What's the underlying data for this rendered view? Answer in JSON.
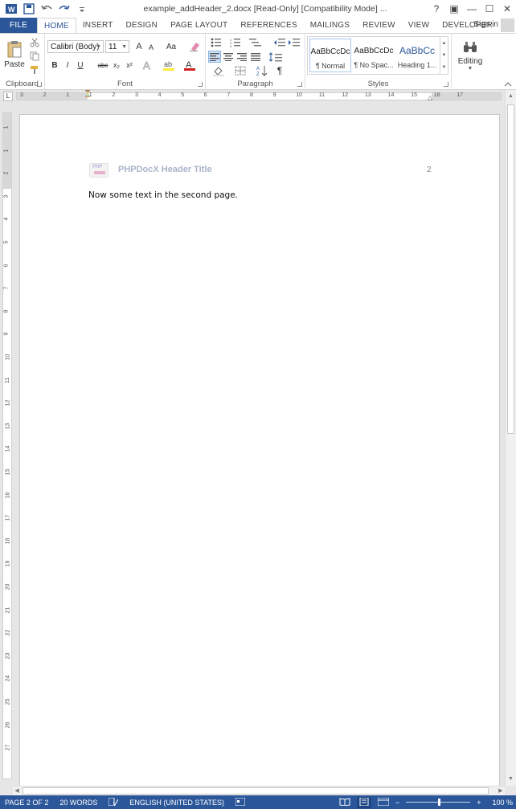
{
  "window": {
    "title": "example_addHeader_2.docx [Read-Only] [Compatibility Mode] ...",
    "help": "?",
    "restore": "▣",
    "minimize": "—",
    "maximize": "☐",
    "close": "✕"
  },
  "tabs": [
    "FILE",
    "HOME",
    "INSERT",
    "DESIGN",
    "PAGE LAYOUT",
    "REFERENCES",
    "MAILINGS",
    "REVIEW",
    "VIEW",
    "DEVELOPER"
  ],
  "active_tab": "HOME",
  "sign_in": "Sign in",
  "ribbon": {
    "clipboard": {
      "paste": "Paste",
      "label": "Clipboard"
    },
    "font": {
      "family": "Calibri (Body)",
      "size": "11",
      "grow": "A",
      "shrink": "A",
      "case": "Aa",
      "bold": "B",
      "italic": "I",
      "underline": "U",
      "strike": "abc",
      "subscript": "x₂",
      "superscript": "x²",
      "label": "Font"
    },
    "paragraph": {
      "label": "Paragraph",
      "pilcrow": "¶"
    },
    "styles": {
      "items": [
        {
          "preview": "AaBbCcDc",
          "name": "¶ Normal"
        },
        {
          "preview": "AaBbCcDc",
          "name": "¶ No Spac..."
        },
        {
          "preview": "AaBbCc",
          "name": "Heading 1..."
        }
      ],
      "label": "Styles"
    },
    "editing": {
      "label": "Editing"
    }
  },
  "ruler": {
    "h_numbers": [
      "3",
      "2",
      "1",
      "1",
      "2",
      "3",
      "4",
      "5",
      "6",
      "7",
      "8",
      "9",
      "10",
      "11",
      "12",
      "13",
      "14",
      "15",
      "16",
      "17"
    ],
    "v_numbers": [
      "1",
      "1",
      "2",
      "3",
      "4",
      "5",
      "6",
      "7",
      "8",
      "9",
      "10",
      "11",
      "12",
      "13",
      "14",
      "15",
      "16",
      "17",
      "18",
      "19",
      "20",
      "21",
      "22",
      "23",
      "24",
      "25",
      "26",
      "27"
    ],
    "tab_marker": "L"
  },
  "document": {
    "header_title": "PHPDocX Header Title",
    "logo_text": "PHP",
    "page_number": "2",
    "body": "Now some text in the second page."
  },
  "status": {
    "page": "PAGE 2 OF 2",
    "words": "20 WORDS",
    "language": "ENGLISH (UNITED STATES)",
    "zoom": "100 %",
    "zoom_minus": "−",
    "zoom_plus": "+"
  },
  "colors": {
    "accent": "#2b579a",
    "header_title": "#aab3c8"
  }
}
